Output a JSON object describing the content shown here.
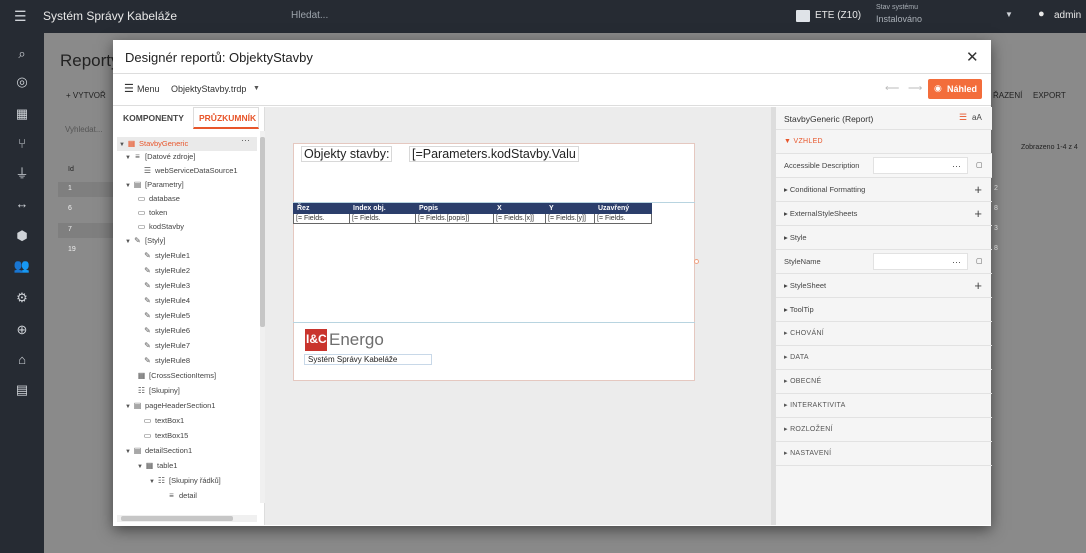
{
  "appbar": {
    "title": "Systém Správy Kabeláže",
    "search_placeholder": "Hledat...",
    "env": "ETE (Z10)",
    "status_label": "Stav systému",
    "status_value": "Instalováno",
    "user": "admin"
  },
  "background": {
    "page_title": "Reporty",
    "create_button": "+ VYTVOŘ",
    "razeni": "ŘAZENÍ",
    "export": "EXPORT",
    "filter_placeholder": "Vyhledat...",
    "showing": "Zobrazeno 1-4 z 4",
    "col_id": "Id",
    "rows": [
      "1",
      "6",
      "7",
      "19"
    ],
    "right_vals": [
      "2",
      "8",
      "3",
      "8"
    ]
  },
  "dialog": {
    "title": "Designér reportů: ObjektyStavby",
    "menu": "Menu",
    "file": "ObjektyStavby.trdp",
    "preview": "Náhled",
    "tabs": [
      "KOMPONENTY",
      "PRŮZKUMNÍK"
    ]
  },
  "tree": [
    "StavbyGeneric",
    "[Datové zdroje]",
    "webServiceDataSource1",
    "[Parametry]",
    "database",
    "token",
    "kodStavby",
    "[Styly]",
    "styleRule1",
    "styleRule2",
    "styleRule3",
    "styleRule4",
    "styleRule5",
    "styleRule6",
    "styleRule7",
    "styleRule8",
    "[CrossSectionItems]",
    "[Skupiny]",
    "pageHeaderSection1",
    "textBox1",
    "textBox15",
    "detailSection1",
    "table1",
    "[Skupiny řádků]",
    "detail"
  ],
  "report": {
    "label": "Objekty stavby:",
    "param_expr": "[=Parameters.kodStavby.Valu",
    "table_headers": [
      "Řez",
      "Index obj.",
      "Popis",
      "X",
      "Y",
      "Uzavřený"
    ],
    "table_cells": [
      "[= Fields.",
      "[= Fields.",
      "[= Fields.[popis]]",
      "[= Fields.[x]]",
      "[= Fields.[y]]",
      "[= Fields."
    ],
    "logo_text": "Energo",
    "logo_prefix": "I&C",
    "footer_text": "Systém Správy Kabeláže"
  },
  "props": {
    "title": "StavbyGeneric (Report)",
    "section_vzhled": "VZHLED",
    "accessible": "Accessible Description",
    "conditional": "Conditional Formatting",
    "external": "ExternalStyleSheets",
    "style": "Style",
    "stylename": "StyleName",
    "stylesheet": "StyleSheet",
    "tooltip": "ToolTip",
    "sections": [
      "CHOVÁNÍ",
      "DATA",
      "OBECNÉ",
      "INTERAKTIVITA",
      "ROZLOŽENÍ",
      "NASTAVENÍ"
    ]
  },
  "colors": {
    "accent": "#f36d3b",
    "tab_active": "#e8562b",
    "table_header": "#2b3e6b",
    "appbar": "#262b33"
  }
}
